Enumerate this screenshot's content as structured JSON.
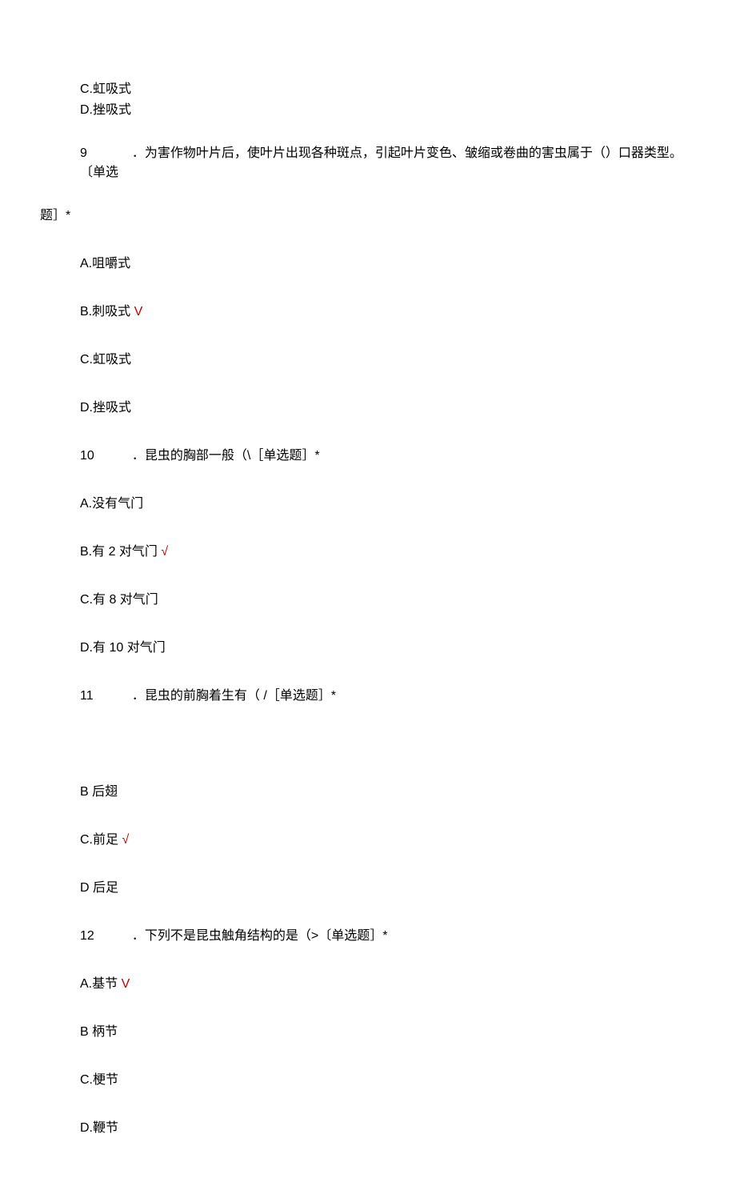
{
  "prelude": {
    "optC": "C.虹吸式",
    "optD": "D.挫吸式"
  },
  "q9": {
    "num": "9",
    "text": "．为害作物叶片后，使叶片出现各种斑点，引起叶片变色、皱缩或卷曲的害虫属于（）口器类型。〔单选",
    "tail": "题］*",
    "optA": "A.咀嚼式",
    "optB": "B.刺吸式",
    "optBmark": " V",
    "optC": "C.虹吸式",
    "optD": "D.挫吸式"
  },
  "q10": {
    "num": "10",
    "text": "．昆虫的胸部一般（\\［单选题］*",
    "optA": "A.没有气门",
    "optB": "B.有 2 对气门",
    "optBmark": " √",
    "optC": "C.有 8 对气门",
    "optD": "D.有 10 对气门"
  },
  "q11": {
    "num": "11",
    "text": "．昆虫的前胸着生有（ /［单选题］*",
    "optB": "B 后翅",
    "optC": "C.前足",
    "optCmark": " √",
    "optD": "D 后足"
  },
  "q12": {
    "num": "12",
    "text": "．下列不是昆虫触角结构的是（>〔单选题］*",
    "optA": "A.基节",
    "optAmark": " V",
    "optB": "B 柄节",
    "optC": "C.梗节",
    "optD": "D.鞭节"
  }
}
